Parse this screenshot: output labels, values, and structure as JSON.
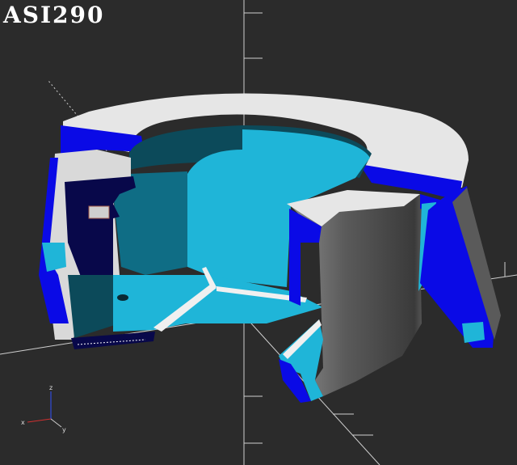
{
  "viewer": {
    "title": "ASI290",
    "background": "#2b2b2b",
    "axis_color": "#cfcfcf",
    "model_colors": {
      "top_face": "#e6e6e6",
      "cut_face": "#0a0ae6",
      "inner_cyan": "#1fb5d8",
      "dark_teal": "#0c4a5a",
      "shadow_gray": "#4a4a4a"
    }
  },
  "gizmo": {
    "x_label": "x",
    "y_label": "y",
    "z_label": "z",
    "x_color": "#d03030",
    "y_color": "#cccccc",
    "z_color": "#3050ff"
  }
}
